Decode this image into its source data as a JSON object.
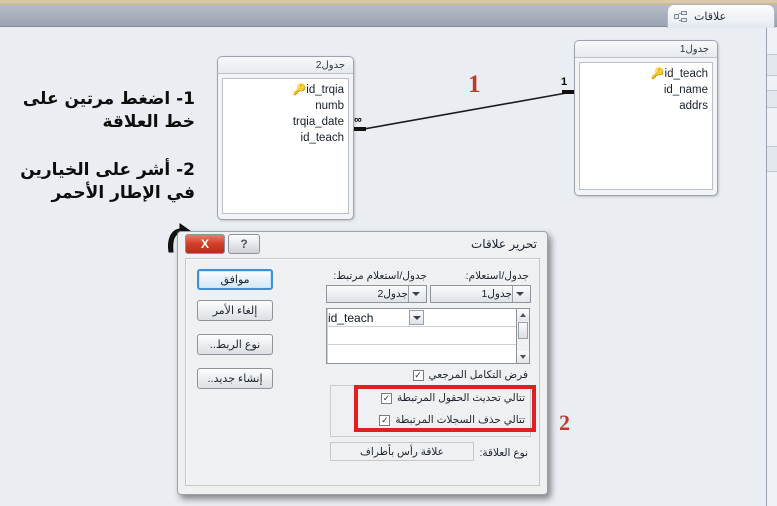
{
  "window": {
    "document_tab_label": "علاقات",
    "tab_icon": "relationships-icon",
    "canvas_background": "#eaeef2",
    "ribbon_band_color": "#a7afbd"
  },
  "diagram": {
    "tables": [
      {
        "name": "جدول2",
        "fields": [
          {
            "label": "id_trqia",
            "primary_key": true
          },
          {
            "label": "numb",
            "primary_key": false
          },
          {
            "label": "trqia_date",
            "primary_key": false
          },
          {
            "label": "id_teach",
            "primary_key": false
          }
        ]
      },
      {
        "name": "جدول1",
        "fields": [
          {
            "label": "id_teach",
            "primary_key": true
          },
          {
            "label": "id_name",
            "primary_key": false
          },
          {
            "label": "addrs",
            "primary_key": false
          }
        ]
      }
    ],
    "relationship": {
      "many_side_symbol": "∞",
      "one_side_symbol": "1"
    }
  },
  "annotations": {
    "marker_color": "#c0392b",
    "step1_marker": "1",
    "step2_marker": "2",
    "step1_text_line1": "1- اضغط مرتين على",
    "step1_text_line2": "خط العلاقة",
    "step2_text_line1": "2- أشر على الخيارين",
    "step2_text_line2": "في الإطار الأحمر",
    "highlight_box_color": "#e01f1f"
  },
  "dialog": {
    "title": "تحرير علاقات",
    "close_label": "X",
    "help_label": "?",
    "buttons": [
      {
        "label": "موافق",
        "primary": true
      },
      {
        "label": "إلغاء الأمر",
        "primary": false
      },
      {
        "label": "نوع الربط..",
        "primary": false
      },
      {
        "label": "إنشاء جديد..",
        "primary": false
      }
    ],
    "left_label": "جدول/استعلام:",
    "right_label": "جدول/استعلام مرتبط:",
    "left_combo_value": "جدول1",
    "right_combo_value": "جدول2",
    "grid_rows": [
      {
        "right_cell": "id_teach",
        "left_cell": ""
      },
      {
        "right_cell": "",
        "left_cell": ""
      },
      {
        "right_cell": "",
        "left_cell": ""
      }
    ],
    "checkboxes": [
      {
        "label": "فرض التكامل المرجعي",
        "checked": true
      },
      {
        "label": "تتالي تحديث الحقول المرتبطة",
        "checked": true
      },
      {
        "label": "تتالي حذف السجلات المرتبطة",
        "checked": true
      }
    ],
    "relationship_type_label": "نوع العلاقة:",
    "relationship_type_value": "علاقة رأس بأطراف"
  }
}
